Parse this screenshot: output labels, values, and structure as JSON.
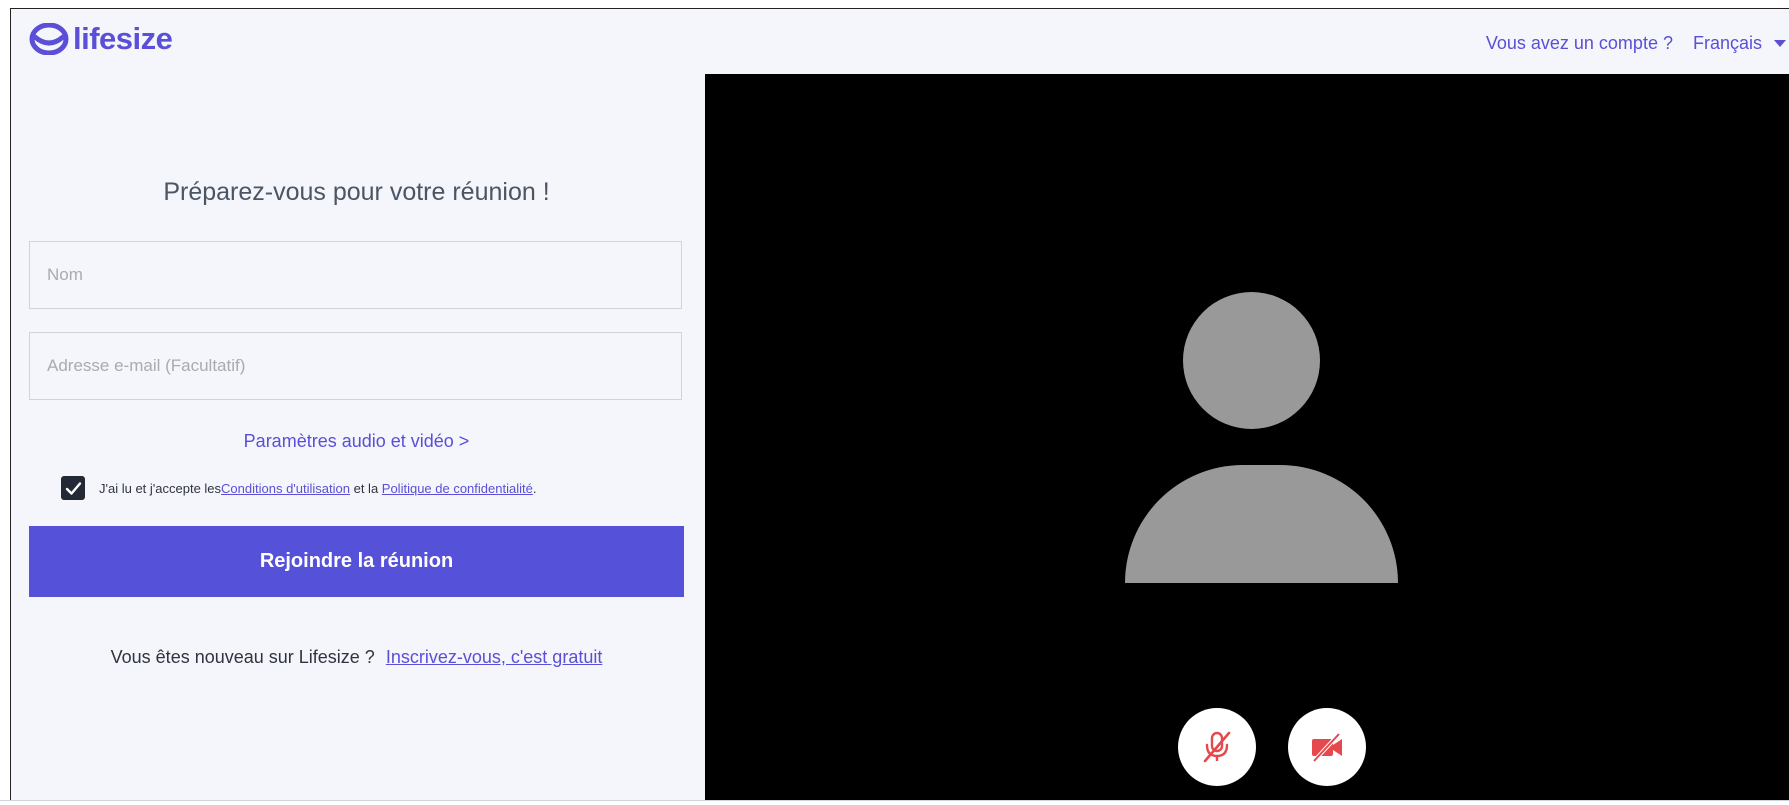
{
  "header": {
    "logo_text": "lifesize",
    "account_link": "Vous avez un compte ?",
    "language": "Français"
  },
  "form": {
    "title": "Préparez-vous pour votre réunion !",
    "name_placeholder": "Nom",
    "email_placeholder": "Adresse e-mail (Facultatif)",
    "av_settings_link": "Paramètres audio et vidéo >",
    "terms": {
      "checked": true,
      "prefix": "J'ai lu et j'accepte les ",
      "terms_link": "Conditions d'utilisation",
      "middle": " et la ",
      "privacy_link": "Politique de confidentialité",
      "suffix": "."
    },
    "join_button": "Rejoindre la réunion",
    "signup_prompt": "Vous êtes nouveau sur Lifesize ? ",
    "signup_link": "Inscrivez-vous, c'est gratuit"
  },
  "video": {
    "mic_icon": "mic-muted-icon",
    "camera_icon": "camera-off-icon"
  },
  "colors": {
    "brand": "#5a4fd6",
    "button": "#5551d8",
    "muted_red": "#e5484d",
    "placeholder_avatar": "#999999"
  }
}
